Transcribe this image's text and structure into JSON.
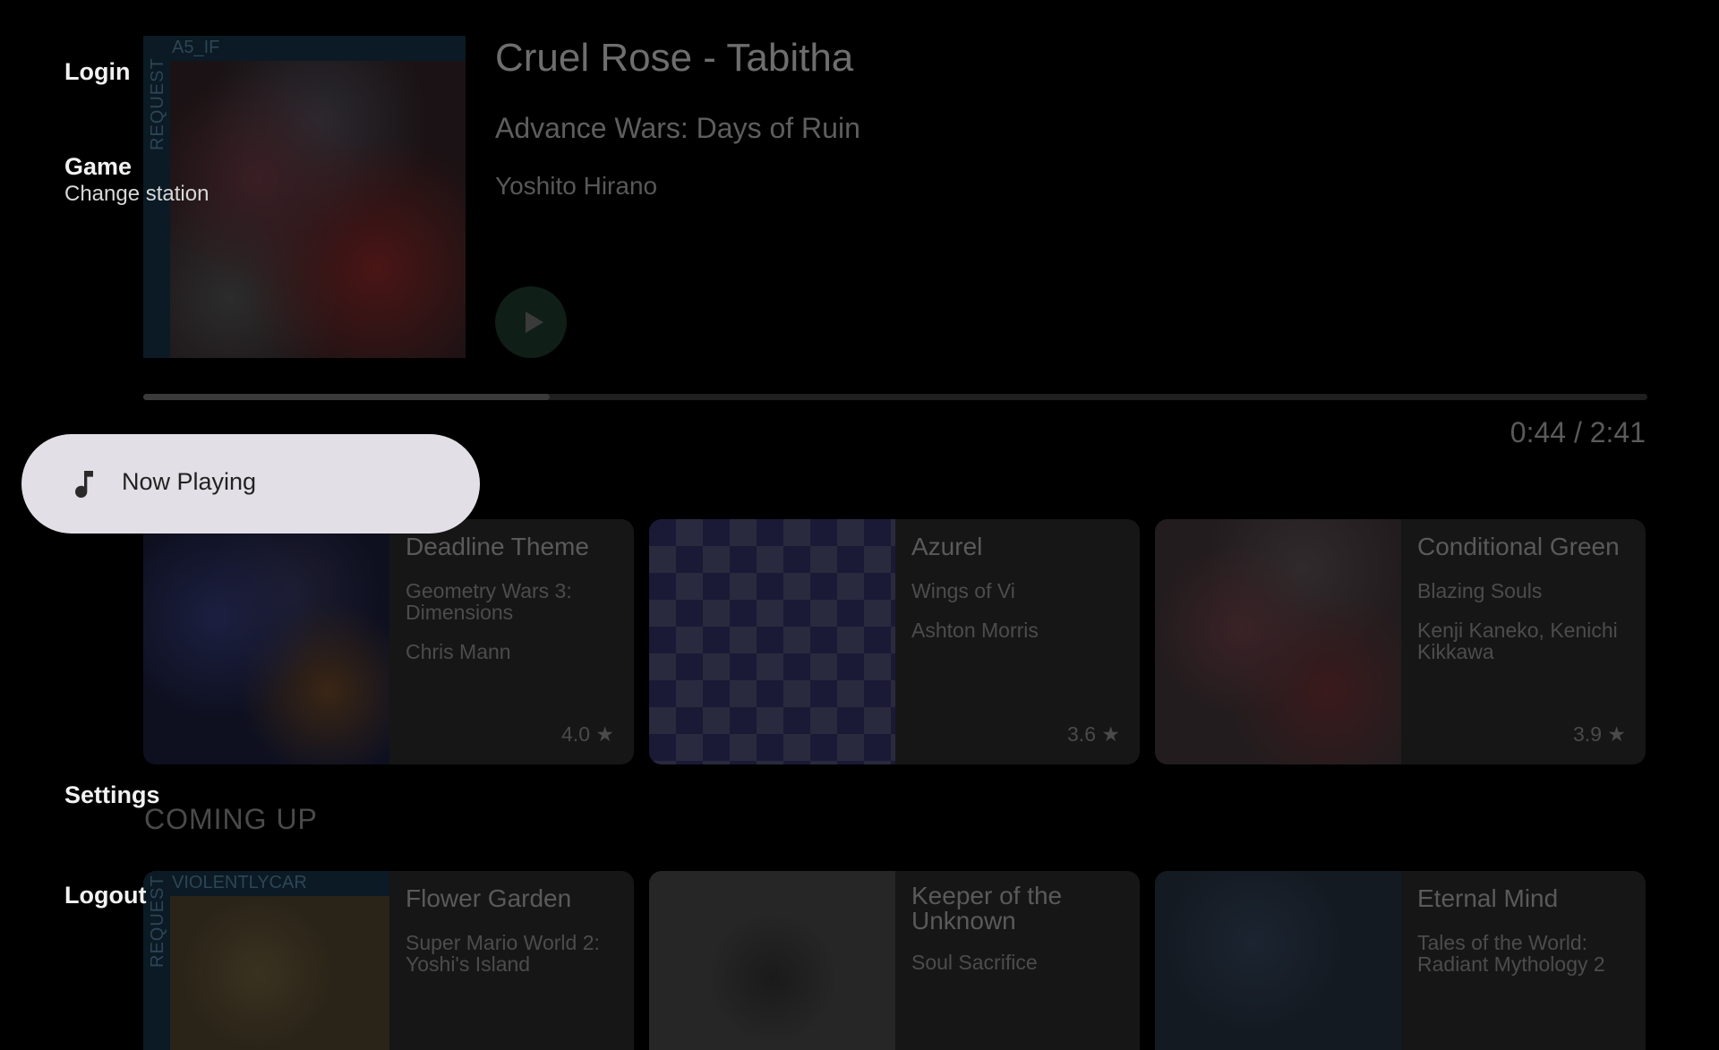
{
  "now_playing": {
    "request_user": "A5_IF",
    "request_label": "REQUEST",
    "title": "Cruel Rose - Tabitha",
    "game": "Advance Wars: Days of Ruin",
    "artist": "Yoshito Hirano",
    "progress_fraction": 0.27,
    "time": "0:44 / 2:41"
  },
  "history": [
    {
      "title": "Deadline Theme",
      "game": "Geometry Wars 3: Dimensions",
      "artist": "Chris Mann",
      "rating": "4.0 ★"
    },
    {
      "title": "Azurel",
      "game": "Wings of Vi",
      "artist": "Ashton Morris",
      "rating": "3.6 ★"
    },
    {
      "title": "Conditional Green",
      "game": "Blazing Souls",
      "artist": "Kenji Kaneko, Kenichi Kikkawa",
      "rating": "3.9 ★"
    }
  ],
  "coming_up": {
    "heading": "COMING UP",
    "items": [
      {
        "title": "Flower Garden",
        "game": "Super Mario World 2: Yoshi's Island",
        "request_user": "VIOLENTLYCAR",
        "request_label": "REQUEST"
      },
      {
        "title": "Keeper of the Unknown",
        "game": "Soul Sacrifice"
      },
      {
        "title": "Eternal Mind",
        "game": "Tales of the World: Radiant Mythology 2"
      }
    ]
  },
  "nav": {
    "login": "Login",
    "game": "Game",
    "change_station": "Change station",
    "now_playing": "Now Playing",
    "settings": "Settings",
    "logout": "Logout"
  },
  "icons": {
    "play": "play-icon",
    "music": "music-note-icon"
  },
  "colors": {
    "pill_bg": "#e3dfe6",
    "play_button": "#0f1f18"
  }
}
